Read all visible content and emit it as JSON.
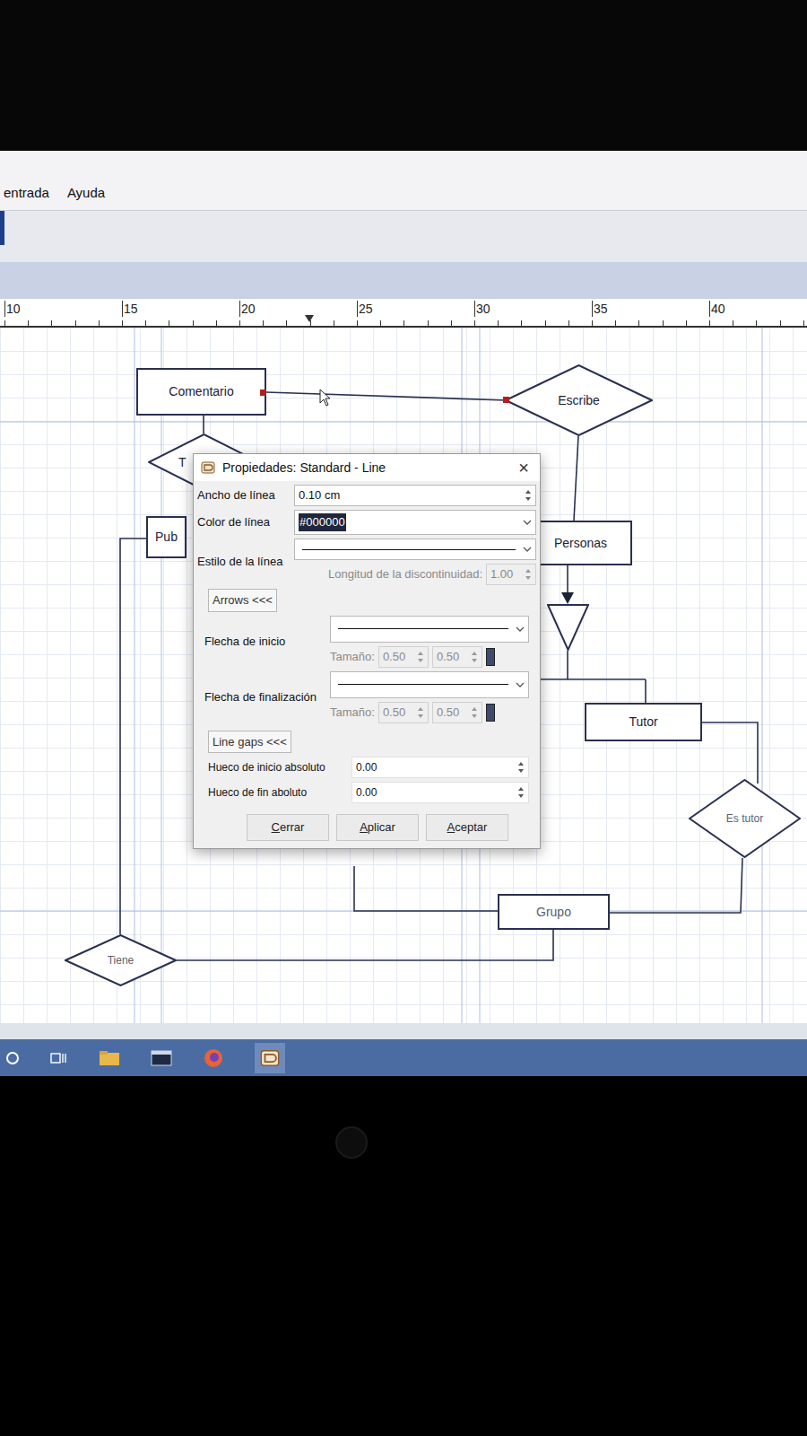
{
  "window": {
    "menu": [
      {
        "label": "entrada"
      },
      {
        "label": "Ayuda"
      }
    ]
  },
  "ruler": {
    "ticks": [
      "10",
      "15",
      "20",
      "25",
      "30",
      "35",
      "40"
    ]
  },
  "diagram": {
    "nodes": [
      {
        "label": "Comentario",
        "kind": "entity"
      },
      {
        "label": "Escribe",
        "kind": "relation"
      },
      {
        "label": "T",
        "kind": "relation"
      },
      {
        "label": "Pub",
        "kind": "entity"
      },
      {
        "label": "Personas",
        "kind": "entity"
      },
      {
        "label": "",
        "kind": "isa"
      },
      {
        "label": "Tutor",
        "kind": "entity"
      },
      {
        "label": "Es tutor",
        "kind": "relation"
      },
      {
        "label": "",
        "kind": "entity"
      },
      {
        "label": "Grupo",
        "kind": "entity"
      },
      {
        "label": "Tiene",
        "kind": "relation"
      }
    ]
  },
  "dialog": {
    "title": "Propiedades: Standard - Line",
    "close": "×",
    "width": {
      "label": "Ancho de línea",
      "value": "0.10 cm"
    },
    "color": {
      "label": "Color de línea",
      "value": "#000000",
      "selected": true
    },
    "style": {
      "label": "Estilo de la línea",
      "dash_label": "Longitud de la discontinuidad:",
      "dash_value": "1.00",
      "dash_disabled": true
    },
    "arrows": {
      "toggle": "Arrows <<<",
      "items": [
        {
          "label": "Flecha de inicio",
          "size_label": "Tamaño:",
          "sizes": [
            "0.50",
            "0.50"
          ],
          "disabled": true
        },
        {
          "label": "Flecha de finalización",
          "size_label": "Tamaño:",
          "sizes": [
            "0.50",
            "0.50"
          ],
          "disabled": true
        }
      ]
    },
    "gaps": {
      "toggle": "Line gaps <<<",
      "items": [
        {
          "label": "Hueco de inicio absoluto",
          "value": "0.00"
        },
        {
          "label": "Hueco de fin aboluto",
          "value": "0.00"
        }
      ]
    },
    "buttons": [
      {
        "label": "Cerrar"
      },
      {
        "label": "Aplicar"
      },
      {
        "label": "Aceptar"
      }
    ]
  }
}
